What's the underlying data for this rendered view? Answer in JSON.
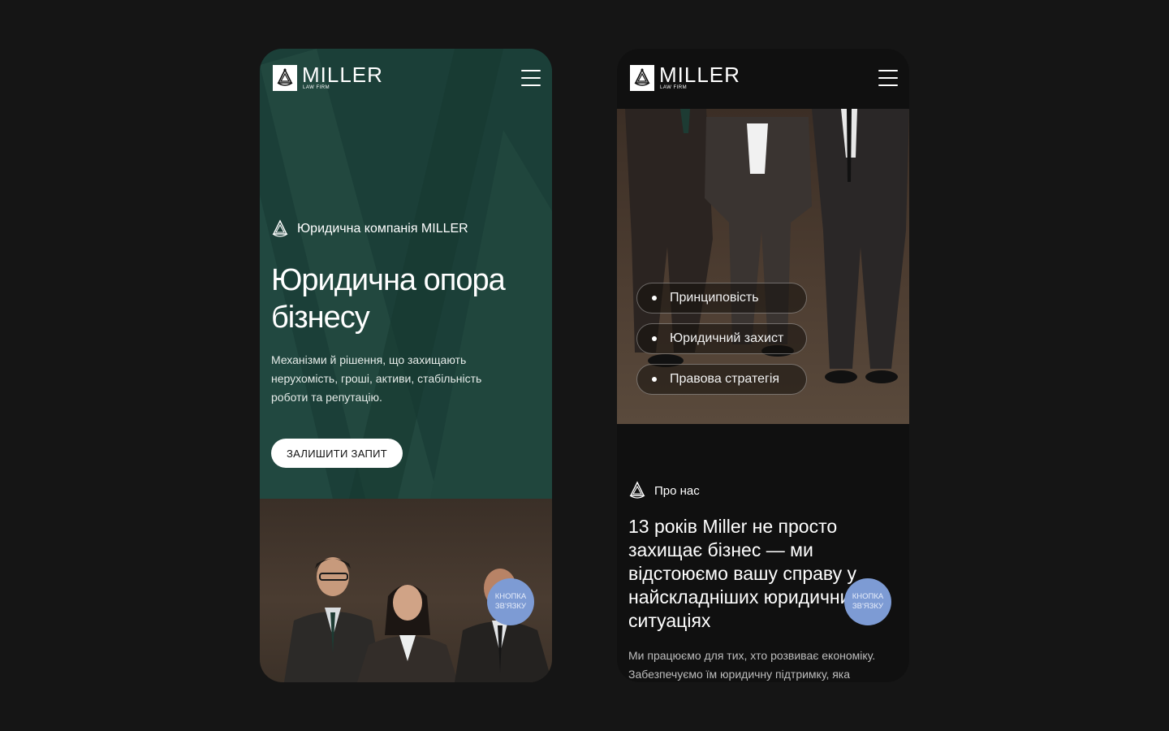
{
  "brand": {
    "name": "MILLER",
    "subtitle": "LAW FIRM"
  },
  "left_screen": {
    "eyebrow": "Юридична компанія MILLER",
    "title": "Юридична опора бізнесу",
    "description": "Механізми й рішення, що захищають нерухомість, гроші, активи, стабільність роботи та репутацію.",
    "cta_label": "ЗАЛИШИТИ ЗАПИТ",
    "contact_button": "КНОПКА ЗВ'ЯЗКУ"
  },
  "right_screen": {
    "values": [
      "Принциповість",
      "Юридичний захист",
      "Правова стратегія"
    ],
    "about_eyebrow": "Про нас",
    "about_title": "13 років Miller не просто захищає бізнес — ми відстоюємо вашу справу у найскладніших юридичних ситуаціях",
    "about_text": "Ми працюємо для тих, хто розвиває економіку. Забезпечуємо їм юридичну підтримку, яка",
    "contact_button": "КНОПКА ЗВ'ЯЗКУ"
  },
  "colors": {
    "page_background": "#151515",
    "hero_green": "#1b3f38",
    "dark_screen": "#101010",
    "contact_button": "#7d9bd4",
    "text_white": "#ffffff"
  },
  "icons": [
    "logo-scales-icon",
    "menu-icon",
    "scales-icon",
    "bullet-dot-icon"
  ]
}
